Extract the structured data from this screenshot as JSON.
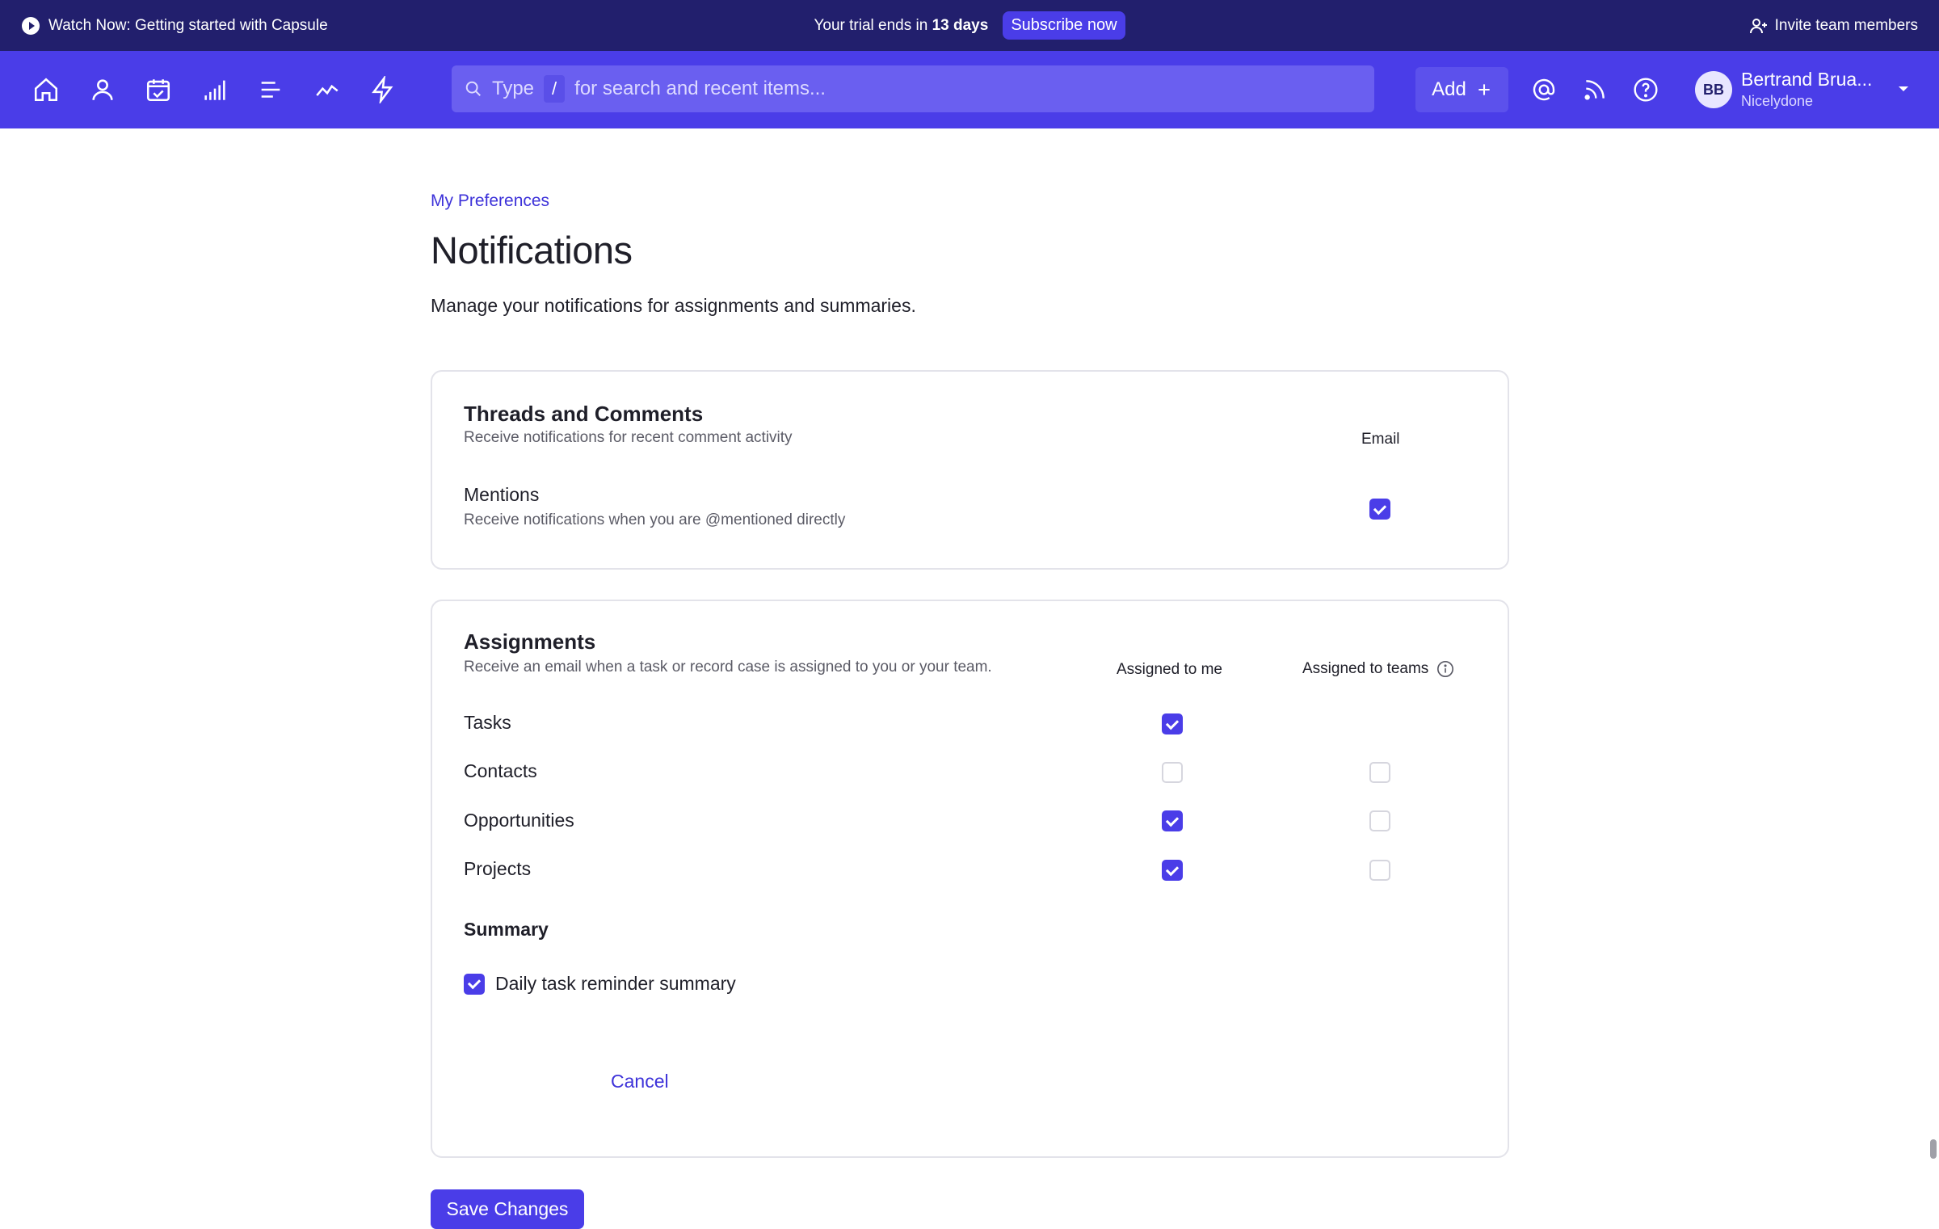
{
  "topbar": {
    "watch_label": "Watch Now: Getting started with Capsule",
    "trial_prefix": "Your trial ends in",
    "trial_days": "13 days",
    "subscribe_label": "Subscribe now",
    "invite_label": "Invite team members"
  },
  "nav": {
    "icons": [
      "home-icon",
      "person-icon",
      "calendar-check-icon",
      "bar-chart-icon",
      "list-icon",
      "trend-icon",
      "lightning-icon"
    ],
    "search_type": "Type",
    "search_key": "/",
    "search_placeholder": "for search and recent items...",
    "add_label": "Add",
    "avatar_initials": "BB",
    "user_name": "Bertrand Brua...",
    "user_org": "Nicelydone"
  },
  "page": {
    "breadcrumb": "My Preferences",
    "title": "Notifications",
    "description": "Manage your notifications for assignments and summaries."
  },
  "threads": {
    "title": "Threads and Comments",
    "subtitle": "Receive notifications for recent comment activity",
    "col_email": "Email",
    "mentions_title": "Mentions",
    "mentions_sub": "Receive notifications when you are @mentioned directly",
    "mentions_email": true
  },
  "assignments": {
    "title": "Assignments",
    "subtitle": "Receive an email when a task or record case is assigned to you or your team.",
    "col_me": "Assigned to me",
    "col_teams": "Assigned to teams",
    "rows": [
      {
        "label": "Tasks",
        "me": true,
        "teams": null
      },
      {
        "label": "Contacts",
        "me": false,
        "teams": false
      },
      {
        "label": "Opportunities",
        "me": true,
        "teams": false
      },
      {
        "label": "Projects",
        "me": true,
        "teams": false
      }
    ]
  },
  "summary": {
    "title": "Summary",
    "daily_label": "Daily task reminder summary",
    "daily_checked": true
  },
  "actions": {
    "save_label": "Save Changes",
    "cancel_label": "Cancel"
  },
  "colors": {
    "topbar": "#221f6d",
    "navbar": "#4a3de8",
    "accent": "#4a3de8"
  }
}
